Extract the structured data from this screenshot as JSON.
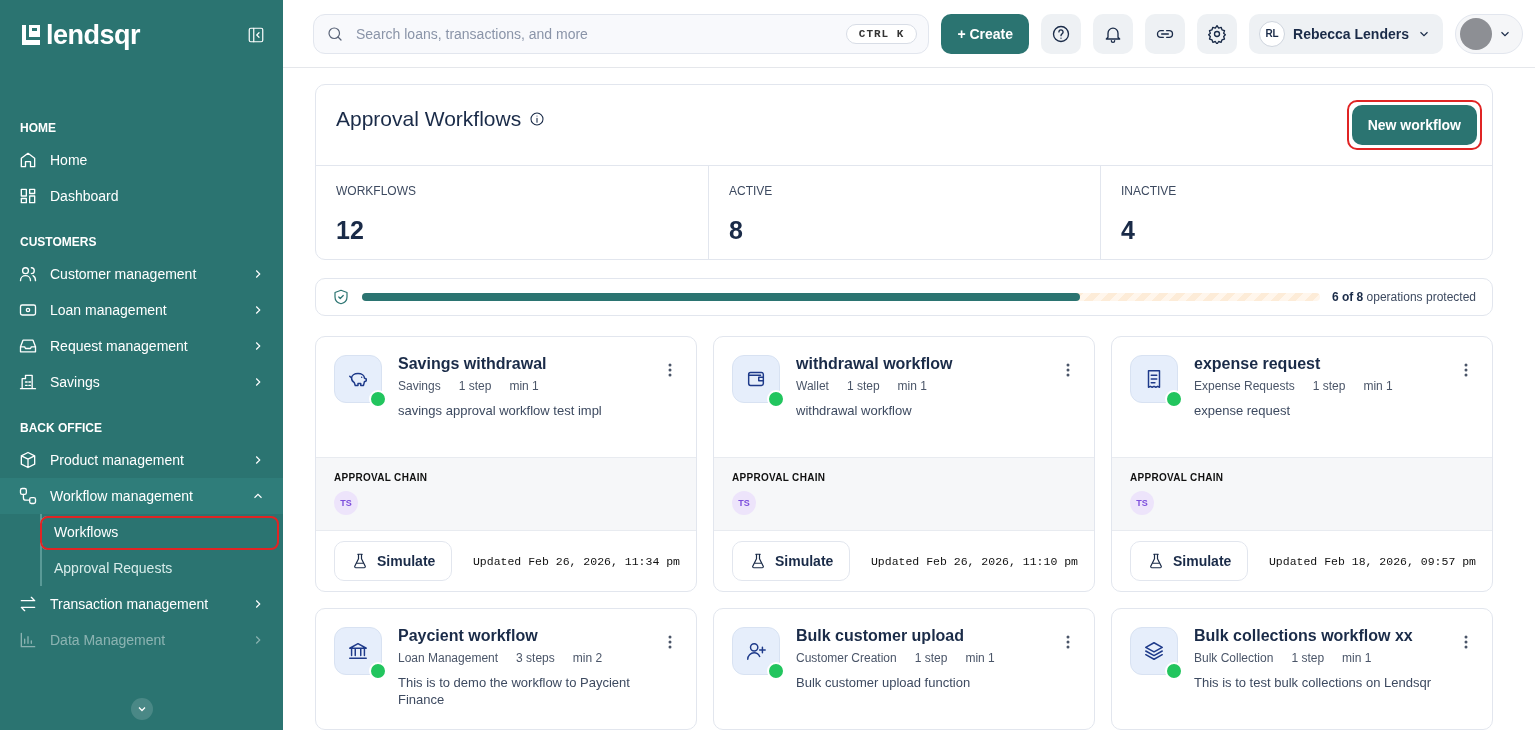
{
  "sidebar": {
    "logo": "lendsqr",
    "items": [
      {
        "kind": "section",
        "label": "HOME"
      },
      {
        "kind": "item",
        "label": "Home",
        "expandable": false,
        "expanded": false,
        "disabled": false
      },
      {
        "kind": "item",
        "label": "Dashboard",
        "expandable": false,
        "expanded": false,
        "disabled": false
      },
      {
        "kind": "section",
        "label": "CUSTOMERS"
      },
      {
        "kind": "item",
        "label": "Customer management",
        "expandable": true,
        "expanded": false,
        "disabled": false
      },
      {
        "kind": "item",
        "label": "Loan management",
        "expandable": true,
        "expanded": false,
        "disabled": false
      },
      {
        "kind": "item",
        "label": "Request management",
        "expandable": true,
        "expanded": false,
        "disabled": false
      },
      {
        "kind": "item",
        "label": "Savings",
        "expandable": true,
        "expanded": false,
        "disabled": false
      },
      {
        "kind": "section",
        "label": "BACK OFFICE"
      },
      {
        "kind": "item",
        "label": "Product management",
        "expandable": true,
        "expanded": false,
        "disabled": false
      },
      {
        "kind": "item",
        "label": "Workflow management",
        "expandable": true,
        "expanded": true,
        "disabled": false,
        "children": [
          {
            "label": "Workflows",
            "selected": true,
            "highlighted": true
          },
          {
            "label": "Approval Requests",
            "selected": false,
            "highlighted": false
          }
        ]
      },
      {
        "kind": "item",
        "label": "Transaction management",
        "expandable": true,
        "expanded": false,
        "disabled": false
      },
      {
        "kind": "item",
        "label": "Data Management",
        "expandable": true,
        "expanded": false,
        "disabled": true
      }
    ]
  },
  "topbar": {
    "search": {
      "placeholder": "Search loans, transactions, and more",
      "shortcut": "CTRL K"
    },
    "create_button": "+ Create",
    "user": {
      "initials": "RL",
      "name": "Rebecca Lenders"
    }
  },
  "header": {
    "title": "Approval Workflows",
    "button": {
      "label": "New workflow",
      "highlighted": true
    }
  },
  "stats": [
    {
      "label": "WORKFLOWS",
      "value": "12"
    },
    {
      "label": "ACTIVE",
      "value": "8"
    },
    {
      "label": "INACTIVE",
      "value": "4"
    }
  ],
  "protection": {
    "level": 0.75,
    "text": "**6 of 8** operations protected"
  },
  "workflows": [
    {
      "title": "Savings withdrawal",
      "active": true,
      "category": "Savings",
      "steps": "1 step",
      "min": "min 1",
      "description": "savings approval workflow test impl",
      "chain_label": "APPROVAL CHAIN",
      "approvers": [
        "TS"
      ],
      "simulate": "Simulate",
      "updated": "Updated Feb 26, 2026, 11:34 pm"
    },
    {
      "title": "withdrawal workflow",
      "active": true,
      "category": "Wallet",
      "steps": "1 step",
      "min": "min 1",
      "description": "withdrawal workflow",
      "chain_label": "APPROVAL CHAIN",
      "approvers": [
        "TS"
      ],
      "simulate": "Simulate",
      "updated": "Updated Feb 26, 2026, 11:10 pm"
    },
    {
      "title": "expense request",
      "active": true,
      "category": "Expense Requests",
      "steps": "1 step",
      "min": "min 1",
      "description": "expense request",
      "chain_label": "APPROVAL CHAIN",
      "approvers": [
        "TS"
      ],
      "simulate": "Simulate",
      "updated": "Updated Feb 18, 2026, 09:57 pm"
    },
    {
      "title": "Paycient workflow",
      "active": true,
      "category": "Loan Management",
      "steps": "3 steps",
      "min": "min 2",
      "description": "This is to demo the workflow to Paycient Finance"
    },
    {
      "title": "Bulk customer upload",
      "active": true,
      "category": "Customer Creation",
      "steps": "1 step",
      "min": "min 1",
      "description": "Bulk customer upload function"
    },
    {
      "title": "Bulk collections workflow xx",
      "active": true,
      "category": "Bulk Collection",
      "steps": "1 step",
      "min": "min 1",
      "description": "This is to test bulk collections on Lendsqr"
    }
  ]
}
